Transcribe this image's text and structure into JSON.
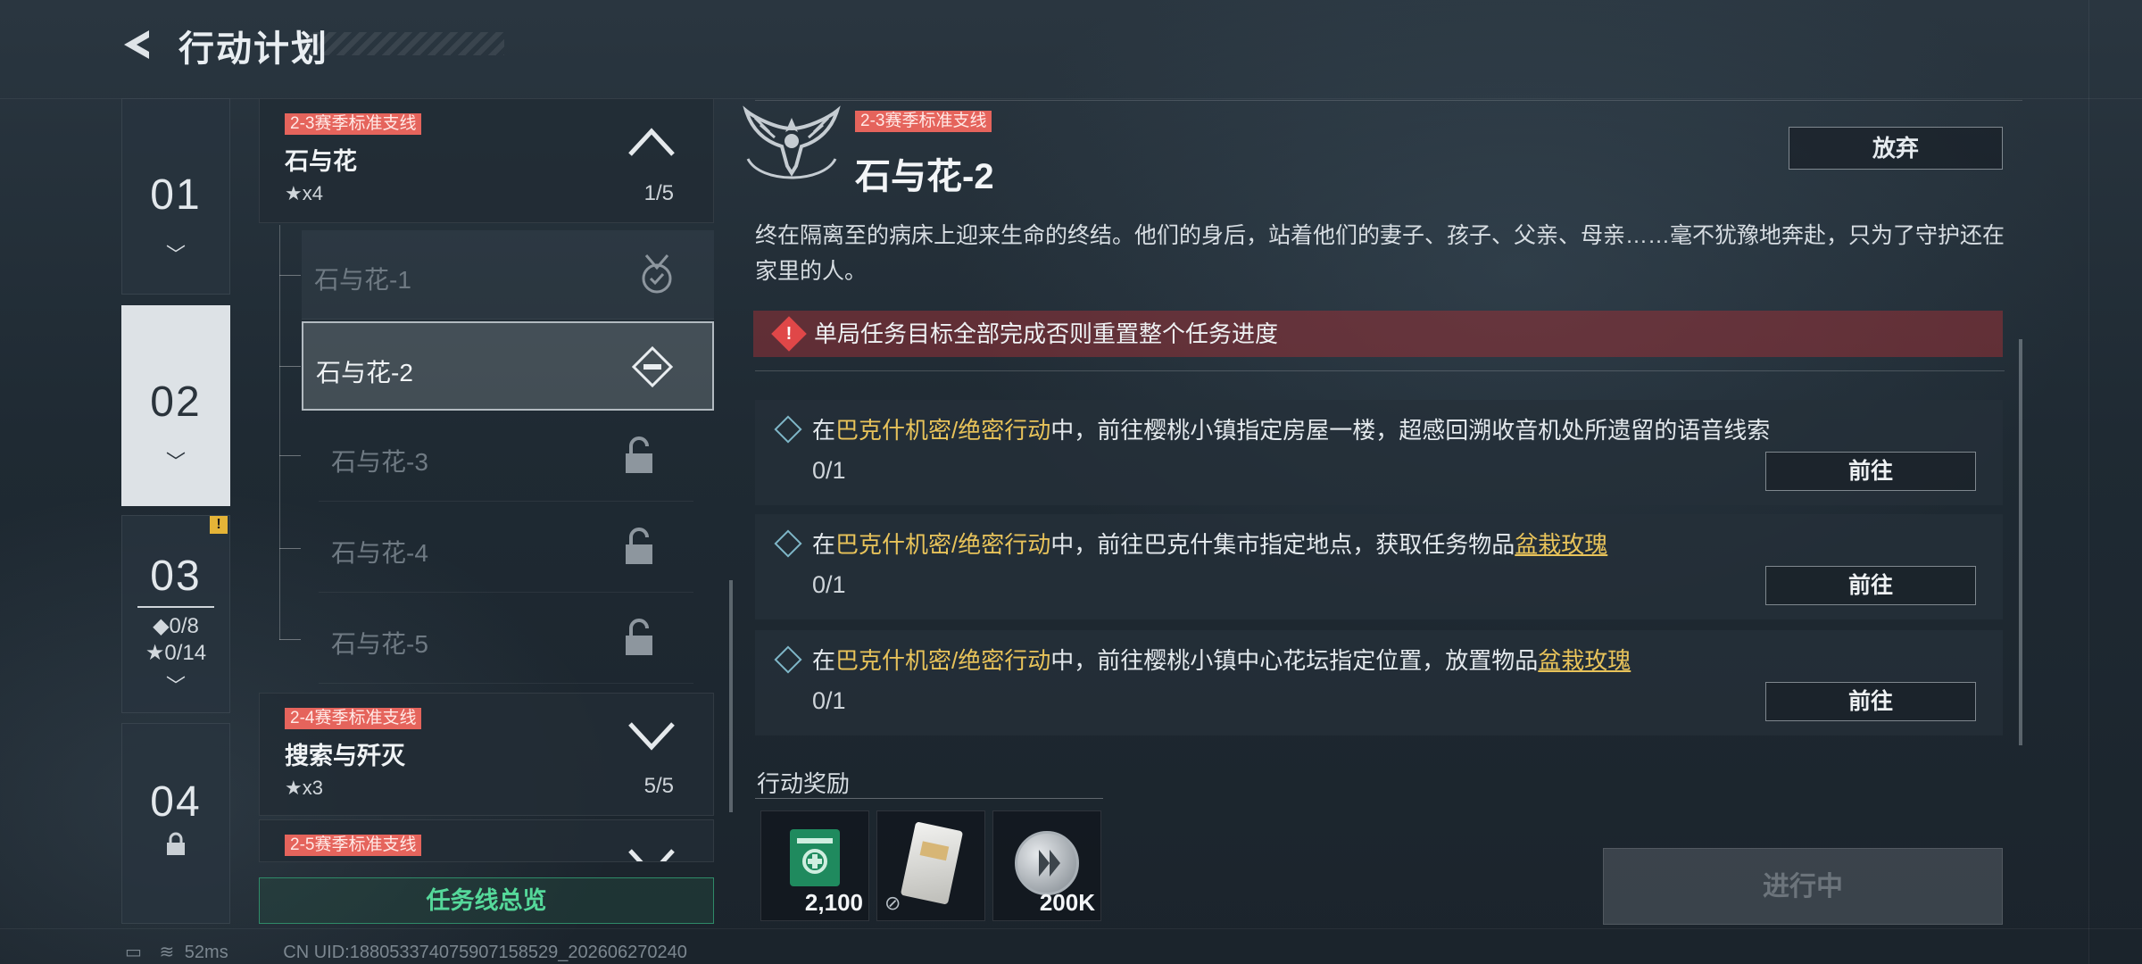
{
  "header": {
    "title": "行动计划"
  },
  "chapters": [
    {
      "num": "01"
    },
    {
      "num": "02"
    },
    {
      "num": "03",
      "badge": "!",
      "stat1": "◆0/8",
      "stat2": "★0/14"
    },
    {
      "num": "04"
    }
  ],
  "questlines": [
    {
      "tag": "2-3赛季标准支线",
      "title": "石与花",
      "stars": "★x4",
      "progress": "1/5"
    },
    {
      "tag": "2-4赛季标准支线",
      "title": "搜索与歼灭",
      "stars": "★x3",
      "progress": "5/5"
    },
    {
      "tag": "2-5赛季标准支线"
    }
  ],
  "subquests": [
    {
      "label": "石与花-1",
      "state": "completed"
    },
    {
      "label": "石与花-2",
      "state": "selected"
    },
    {
      "label": "石与花-3",
      "state": "locked"
    },
    {
      "label": "石与花-4",
      "state": "locked"
    },
    {
      "label": "石与花-5",
      "state": "locked"
    }
  ],
  "overview_button": "任务线总览",
  "detail": {
    "tag": "2-3赛季标准支线",
    "title": "石与花-2",
    "abandon": "放弃",
    "description": "终在隔离至的病床上迎来生命的终结。他们的身后，站着他们的妻子、孩子、父亲、母亲……毫不犹豫地奔赴，只为了守护还在家里的人。",
    "alert": "单局任务目标全部完成否则重置整个任务进度"
  },
  "tasks": [
    {
      "pre": "在",
      "hl": "巴克什机密/绝密行动",
      "mid": "中，前往樱桃小镇指定房屋一楼，超感回溯收音机处所遗留的语音线索",
      "item": "",
      "progress": "0/1",
      "button": "前往"
    },
    {
      "pre": "在",
      "hl": "巴克什机密/绝密行动",
      "mid": "中，前往巴克什集市指定地点，获取任务物品",
      "item": "盆栽玫瑰",
      "progress": "0/1",
      "button": "前往"
    },
    {
      "pre": "在",
      "hl": "巴克什机密/绝密行动",
      "mid": "中，前往樱桃小镇中心花坛指定位置，放置物品",
      "item": "盆栽玫瑰",
      "progress": "0/1",
      "button": "前往"
    }
  ],
  "rewards": {
    "label": "行动奖励",
    "items": [
      {
        "icon": "medkit-card-icon",
        "qty": "2,100"
      },
      {
        "icon": "keycard-icon",
        "qty": ""
      },
      {
        "icon": "coin-icon",
        "qty": "200K"
      }
    ]
  },
  "status_button": "进行中",
  "status_bar": {
    "ping": "52ms",
    "uid": "CN UID:18805337407590715852​9_202606270240"
  },
  "colors": {
    "accent_green": "#55d89a",
    "tag_red": "#e5645c",
    "highlight_gold": "#e8c35a",
    "alert_red": "#e04748"
  }
}
